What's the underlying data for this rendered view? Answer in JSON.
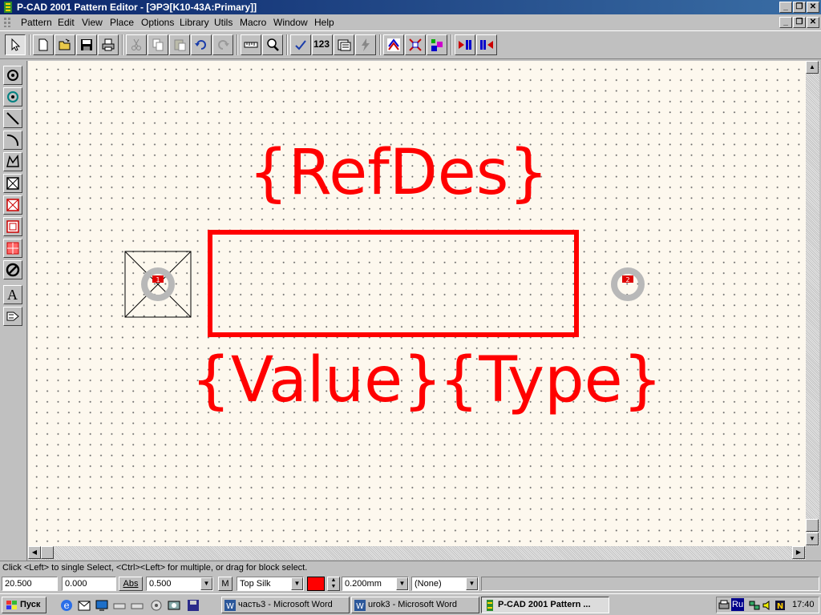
{
  "window": {
    "title": "P-CAD 2001 Pattern Editor - [ЭРЭ[K10-43A:Primary]]",
    "minimize": "_",
    "restore": "❐",
    "close": "✕"
  },
  "menu": {
    "items": [
      "Pattern",
      "Edit",
      "View",
      "Place",
      "Options",
      "Library",
      "Utils",
      "Macro",
      "Window",
      "Help"
    ]
  },
  "toolbar": {
    "label_123": "123",
    "icons": [
      "select-arrow-icon",
      "new-file-icon",
      "open-folder-icon",
      "save-icon",
      "print-icon",
      "cut-icon",
      "copy-icon",
      "paste-icon",
      "undo-icon",
      "redo-icon",
      "measure-icon",
      "zoom-icon",
      "check-icon",
      "renumber-icon",
      "pattern-wizard-icon",
      "lightning-icon",
      "pad-icon-1",
      "pad-icon-2",
      "pad-icon-3",
      "pad-icon-4",
      "pad-icon-5"
    ]
  },
  "left_tools": {
    "icons": [
      "place-pad-icon",
      "place-via-icon",
      "place-line-icon",
      "place-arc-icon",
      "place-polygon-icon",
      "place-copper-pour-icon",
      "place-cutout-icon",
      "place-keepout-icon",
      "place-plane-icon",
      "place-prohibit-icon",
      "place-text-icon",
      "place-attribute-icon"
    ],
    "text_tool_label": "A"
  },
  "canvas": {
    "refdes": "{RefDes}",
    "value": "{Value}",
    "type": "{Type}",
    "pad1_label": "1",
    "pad2_label": "2",
    "silk_color": "#ff0000",
    "background": "#fdf8ee"
  },
  "status": {
    "message": "Click <Left> to single Select, <Ctrl><Left> for multiple, or drag for block select.",
    "x": "20.500",
    "y": "0.000",
    "abs_label": "Abs",
    "grid": "0.500",
    "m_label": "M",
    "layer": "Top Silk",
    "layer_color": "#ff0000",
    "line_width": "0.200mm",
    "net": "(None)"
  },
  "taskbar": {
    "start": "Пуск",
    "tasks": [
      "часть3 - Microsoft Word",
      "urok3 - Microsoft Word",
      "P-CAD 2001 Pattern ..."
    ],
    "tray_lang": "Ru",
    "time": "17:40"
  }
}
